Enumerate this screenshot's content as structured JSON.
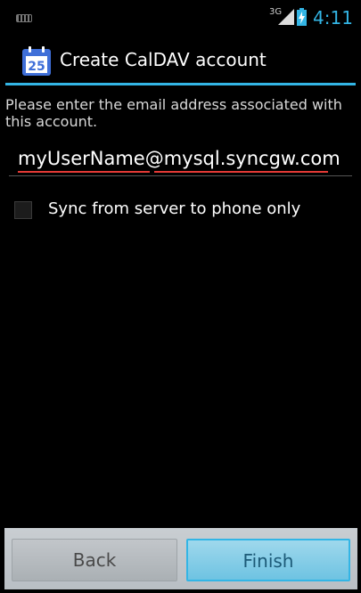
{
  "status_bar": {
    "network_type": "3G",
    "time": "4:11",
    "clock_color": "#33b5e5",
    "icons": [
      "keyboard-icon",
      "signal-icon",
      "battery-charging-icon"
    ]
  },
  "action_bar": {
    "app_icon_day": "25",
    "title": "Create CalDAV account",
    "accent_color": "#33b5e5"
  },
  "form": {
    "instructions": "Please enter the email address associated with this account.",
    "email_value": "myUserName@mysql.syncgw.com",
    "sync_option_label": "Sync from server to phone only",
    "sync_option_checked": false
  },
  "buttons": {
    "back_label": "Back",
    "finish_label": "Finish"
  }
}
